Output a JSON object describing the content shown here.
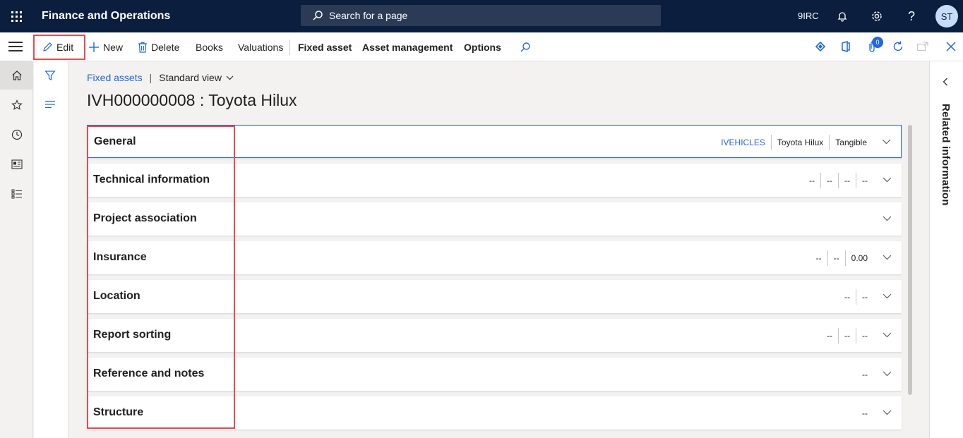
{
  "topbar": {
    "app_title": "Finance and Operations",
    "search_placeholder": "Search for a page",
    "company": "9IRC",
    "user_initials": "ST"
  },
  "actionpane": {
    "edit": "Edit",
    "new": "New",
    "delete": "Delete",
    "books": "Books",
    "valuations": "Valuations",
    "fixed_asset": "Fixed asset",
    "asset_management": "Asset management",
    "options": "Options",
    "notification_count": "0"
  },
  "breadcrumb": {
    "link": "Fixed assets",
    "separator": "|",
    "view": "Standard view"
  },
  "page_title": "IVH000000008 : Toyota Hilux",
  "fasttabs": [
    {
      "title": "General",
      "summary": [
        "IVEHICLES",
        "Toyota Hilux",
        "Tangible"
      ]
    },
    {
      "title": "Technical information",
      "summary": [
        "--",
        "--",
        "--",
        "--"
      ]
    },
    {
      "title": "Project association",
      "summary": []
    },
    {
      "title": "Insurance",
      "summary": [
        "--",
        "--",
        "0.00"
      ]
    },
    {
      "title": "Location",
      "summary": [
        "--",
        "--"
      ]
    },
    {
      "title": "Report sorting",
      "summary": [
        "--",
        "--",
        "--"
      ]
    },
    {
      "title": "Reference and notes",
      "summary": [
        "--"
      ]
    },
    {
      "title": "Structure",
      "summary": [
        "--"
      ]
    }
  ],
  "related_pane": {
    "label": "Related information"
  },
  "colors": {
    "topbar": "#0b1e3d",
    "accent": "#2266e3",
    "highlight": "#e74c4c"
  }
}
